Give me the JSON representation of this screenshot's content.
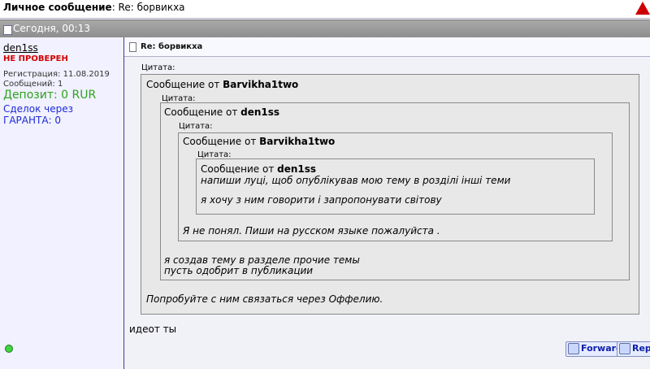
{
  "header": {
    "title_bold": "Личное сообщение",
    "title_rest": ": Re: борвикха"
  },
  "datebar": {
    "text": "Сегодня, 00:13"
  },
  "sidebar": {
    "username": "den1ss",
    "status": "НЕ ПРОВЕРЕН",
    "registered": "Регистрация: 11.08.2019",
    "messages": "Сообщений: 1",
    "deposit": "Депозит: 0 RUR",
    "deals": "Сделок через ГАРАНТА: 0"
  },
  "post": {
    "subject": "Re: борвикха",
    "quote_label": "Цитата:",
    "q1": {
      "prefix": "Сообщение от ",
      "author": "Barvikha1two",
      "text": "Попробуйте с ним связаться через Оффелию."
    },
    "q2": {
      "prefix": "Сообщение от ",
      "author": "den1ss",
      "text1": "я создав тему в разделе прочие темы",
      "text2": "пусть одобрит в публикации"
    },
    "q3": {
      "prefix": "Сообщение от ",
      "author": "Barvikha1two",
      "text": "Я не понял. Пиши на русском языке пожалуйста ."
    },
    "q4": {
      "prefix": "Сообщение от ",
      "author": "den1ss",
      "text1": "напиши луці, щоб опублікував мою тему в розділі інші теми",
      "text2": "я хочу з ним говорити і запропонувати світову"
    },
    "reply": "идеот ты",
    "forward_label": "Forward",
    "reply_label": "Reply"
  }
}
